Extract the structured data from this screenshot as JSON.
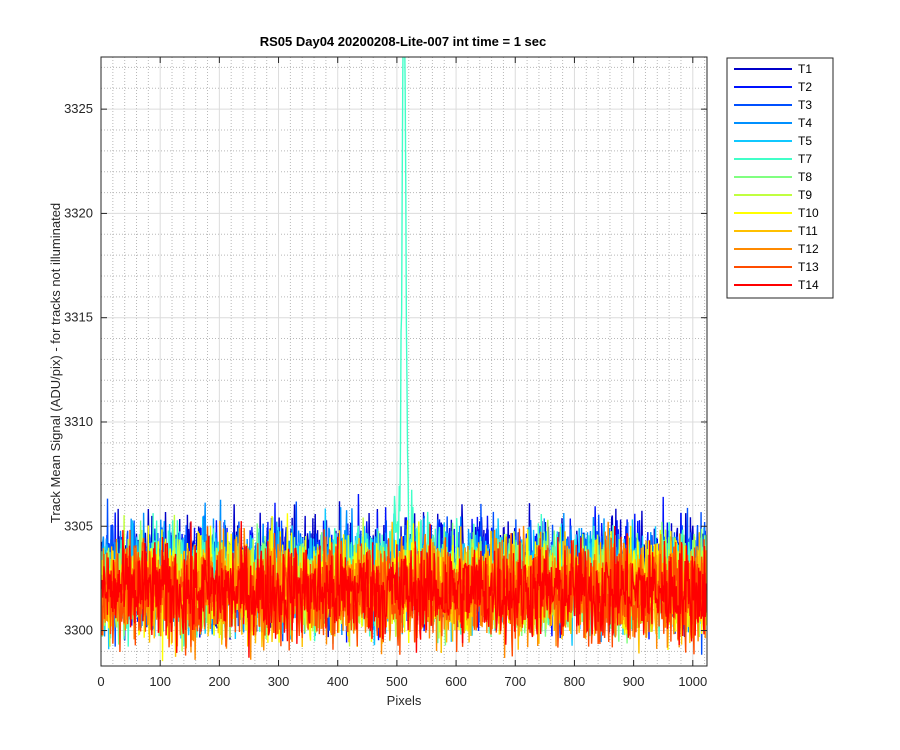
{
  "chart_data": {
    "type": "line",
    "title": "RS05 Day04 20200208-Lite-007 int time = 1 sec",
    "xlabel": "Pixels",
    "ylabel": "Track Mean Signal (ADU/pix) - for tracks not illuminated",
    "xlim": [
      0,
      1024
    ],
    "ylim": [
      3298.3,
      3327.5
    ],
    "x_ticks": [
      0,
      100,
      200,
      300,
      400,
      500,
      600,
      700,
      800,
      900,
      1000
    ],
    "y_ticks": [
      3300,
      3305,
      3310,
      3315,
      3320,
      3325
    ],
    "grid": true,
    "minor_grid": true,
    "legend_position": "outside-top-right",
    "x_points": 1024,
    "series": [
      {
        "name": "T1",
        "color": "#0000c8",
        "mean": 3302.9,
        "noise": 1.3
      },
      {
        "name": "T2",
        "color": "#0012ff",
        "mean": 3302.8,
        "noise": 1.3
      },
      {
        "name": "T3",
        "color": "#0050ff",
        "mean": 3302.7,
        "noise": 1.3
      },
      {
        "name": "T4",
        "color": "#0090ff",
        "mean": 3302.6,
        "noise": 1.25
      },
      {
        "name": "T5",
        "color": "#10c8ff",
        "mean": 3302.5,
        "noise": 1.25
      },
      {
        "name": "T7",
        "color": "#40ffc8",
        "mean": 3302.4,
        "noise": 1.2,
        "peak": {
          "x": 512,
          "value": 3327.5
        }
      },
      {
        "name": "T8",
        "color": "#80ff80",
        "mean": 3302.3,
        "noise": 1.2
      },
      {
        "name": "T9",
        "color": "#c0ff40",
        "mean": 3302.2,
        "noise": 1.2
      },
      {
        "name": "T10",
        "color": "#ffff00",
        "mean": 3302.1,
        "noise": 1.2
      },
      {
        "name": "T11",
        "color": "#ffc000",
        "mean": 3302.0,
        "noise": 1.2
      },
      {
        "name": "T12",
        "color": "#ff8a00",
        "mean": 3301.9,
        "noise": 1.25
      },
      {
        "name": "T13",
        "color": "#ff4c00",
        "mean": 3301.9,
        "noise": 1.25
      },
      {
        "name": "T14",
        "color": "#ff0000",
        "mean": 3301.9,
        "noise": 1.2
      }
    ]
  }
}
